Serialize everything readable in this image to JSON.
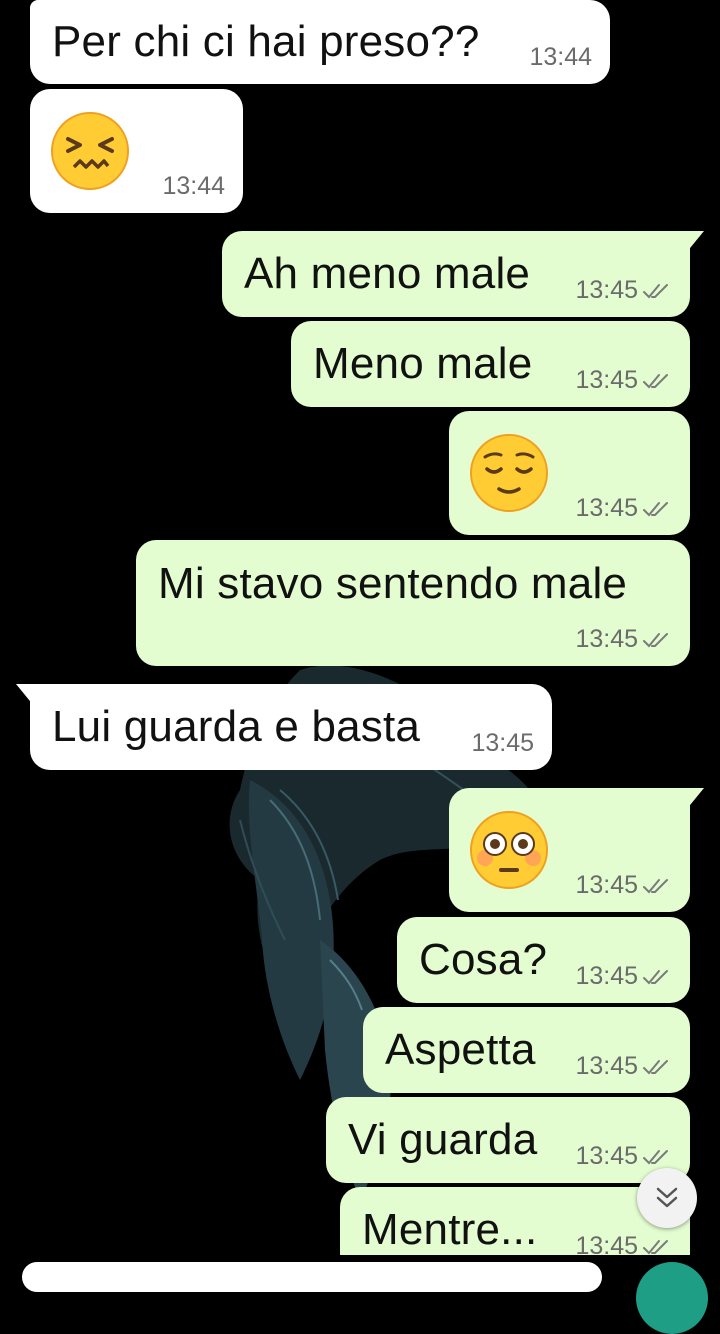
{
  "messages": [
    {
      "text": "Per chi ci hai preso??",
      "time": "13:44"
    },
    {
      "emoji": "confounded-face",
      "time": "13:44"
    },
    {
      "text": "Ah meno male",
      "time": "13:45"
    },
    {
      "text": "Meno male",
      "time": "13:45"
    },
    {
      "emoji": "relieved-face",
      "time": "13:45"
    },
    {
      "text": "Mi stavo sentendo male",
      "time": "13:45"
    },
    {
      "text": "Lui guarda e basta",
      "time": "13:45"
    },
    {
      "emoji": "flushed-face",
      "time": "13:45"
    },
    {
      "text": "Cosa?",
      "time": "13:45"
    },
    {
      "text": "Aspetta",
      "time": "13:45"
    },
    {
      "text": "Vi guarda",
      "time": "13:45"
    },
    {
      "text": "Mentre...",
      "time": "13:45"
    }
  ],
  "colors": {
    "incoming_bubble": "#ffffff",
    "outgoing_bubble": "#e3fdd0",
    "background": "#000000",
    "read_ticks": "#7a7a7a",
    "mic_button": "#1f9e86"
  },
  "icons": {
    "read_status": "double-check-icon",
    "scroll_down": "double-chevron-down-icon",
    "mic": "mic-icon"
  }
}
